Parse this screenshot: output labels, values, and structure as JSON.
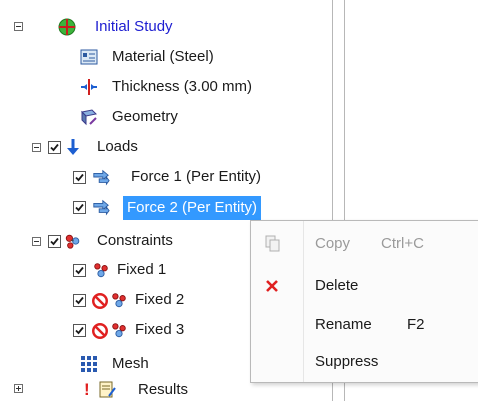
{
  "tree": {
    "study": {
      "label": "Initial Study",
      "color": "#1d1dd1"
    },
    "material": {
      "label": "Material (Steel)"
    },
    "thickness": {
      "label": "Thickness (3.00 mm)"
    },
    "geometry": {
      "label": "Geometry"
    },
    "loads": {
      "label": "Loads",
      "items": [
        {
          "label": "Force 1 (Per Entity)",
          "checked": true,
          "selected": false
        },
        {
          "label": "Force 2 (Per Entity)",
          "checked": true,
          "selected": true
        }
      ]
    },
    "constraints": {
      "label": "Constraints",
      "items": [
        {
          "label": "Fixed 1",
          "checked": true,
          "suppressed": false
        },
        {
          "label": "Fixed 2",
          "checked": true,
          "suppressed": true
        },
        {
          "label": "Fixed 3",
          "checked": true,
          "suppressed": true
        }
      ]
    },
    "mesh": {
      "label": "Mesh"
    },
    "results": {
      "label": "Results",
      "warning": "!"
    }
  },
  "context_menu": {
    "copy": {
      "label": "Copy",
      "shortcut": "Ctrl+C",
      "enabled": false
    },
    "delete": {
      "label": "Delete"
    },
    "rename": {
      "label": "Rename",
      "shortcut": "F2"
    },
    "suppress": {
      "label": "Suppress"
    }
  },
  "colors": {
    "selection": "#3399ff",
    "accent_red": "#e02020",
    "link_blue": "#1d1dd1"
  }
}
